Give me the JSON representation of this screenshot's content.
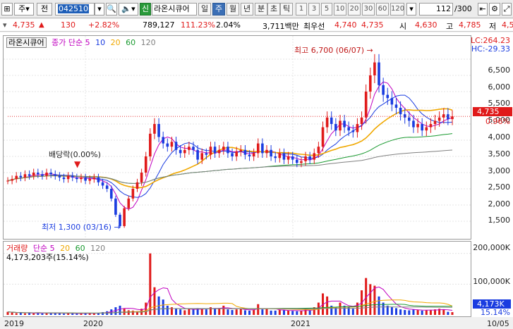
{
  "toolbar": {
    "market_label": "주",
    "jeon_label": "전",
    "code_value": "042510",
    "sin_label": "신",
    "stock_name": "라온시큐어",
    "period_day": "일",
    "period_week": "주",
    "period_month": "월",
    "period_year": "년",
    "period_min": "분",
    "period_sec": "초",
    "period_tick": "틱",
    "intervals": [
      "1",
      "3",
      "5",
      "10",
      "20",
      "30",
      "60",
      "120"
    ],
    "count_value": "112",
    "count_total": "/300"
  },
  "quote": {
    "price": "4,735",
    "change_arrow": "▲",
    "change": "130",
    "change_pct": "+2.82%",
    "volume": "789,127",
    "vol_ratio": "111.23%",
    "turnover": "2.04%",
    "amount": "3,711백만",
    "best_ask_label": "최우선",
    "best_ask": "4,740",
    "best_bid": "4,735",
    "open_label": "시",
    "open": "4,630",
    "high_label": "고",
    "high": "4,785",
    "low_label": "저",
    "low_partial": "4,5"
  },
  "legend": {
    "stock_name": "라온시큐어",
    "ma_label": "종가 단순",
    "ma_periods": [
      "5",
      "10",
      "20",
      "60",
      "120"
    ],
    "vol_label": "거래량",
    "vol_ma_label": "단순",
    "vol_ma_periods": [
      "5",
      "20",
      "60",
      "120"
    ],
    "vol_value": "4,173,203주(15.14%)"
  },
  "annotations": {
    "high": "최고 6,700 (06/07)",
    "low": "최저 1,300 (03/16)",
    "dividend": "배당락(0.00%)"
  },
  "price_axis": {
    "lc": "LC:264.23",
    "hc": "HC:-29.33",
    "current_price": "4,735",
    "current_pct": "0.96%",
    "ticks": [
      "6,500",
      "6,000",
      "5,500",
      "5,000",
      "4,500",
      "4,000",
      "3,500",
      "3,000",
      "2,500",
      "2,000",
      "1,500"
    ]
  },
  "volume_axis": {
    "ticks": [
      "200,000K",
      "100,000K"
    ],
    "current": "4,173K",
    "current_pct": "15.14%"
  },
  "dates": [
    "2019",
    "2020",
    "2021",
    "10/05"
  ],
  "colors": {
    "up": "#e01a1a",
    "down": "#1a3ce0",
    "ma5": "#c000c0",
    "ma10": "#1a3ce0",
    "ma20": "#f0a800",
    "ma60": "#1a9a30",
    "ma120": "#808080"
  },
  "chart_data": {
    "type": "candlestick",
    "title": "라온시큐어",
    "x": [
      "2019",
      "2020",
      "2021"
    ],
    "ylim": [
      1000,
      7000
    ],
    "high_point": {
      "value": 6700,
      "date": "06/07"
    },
    "low_point": {
      "value": 1300,
      "date": "03/16"
    },
    "close_series": [
      2750,
      2800,
      2900,
      2850,
      2950,
      2900,
      3000,
      2950,
      2900,
      3000,
      2950,
      2900,
      2850,
      2800,
      2900,
      2850,
      2800,
      2850,
      2750,
      2800,
      2850,
      2700,
      2600,
      2500,
      2200,
      1700,
      1350,
      1900,
      2200,
      2500,
      2700,
      3000,
      3500,
      4200,
      4500,
      4100,
      3900,
      3800,
      3950,
      3700,
      3600,
      3700,
      3800,
      3700,
      3400,
      3600,
      3550,
      3800,
      3600,
      3700,
      3800,
      3600,
      3500,
      3650,
      3700,
      3550,
      3500,
      3600,
      3900,
      3600,
      3700,
      3500,
      3450,
      3600,
      3400,
      3500,
      3400,
      3300,
      3350,
      3500,
      3400,
      3600,
      3800,
      4400,
      4700,
      4500,
      4300,
      4600,
      4400,
      4300,
      4250,
      4500,
      4700,
      5500,
      6000,
      6400,
      5700,
      5400,
      5300,
      5100,
      5000,
      4800,
      4700,
      4600,
      4400,
      4500,
      4300,
      4400,
      4500,
      4600,
      4700,
      4800,
      4650,
      4735
    ],
    "volume_series": [
      10,
      8,
      6,
      7,
      5,
      6,
      6,
      8,
      5,
      5,
      6,
      7,
      6,
      4,
      5,
      5,
      4,
      6,
      5,
      5,
      6,
      7,
      9,
      12,
      18,
      25,
      30,
      20,
      15,
      14,
      12,
      20,
      40,
      200,
      90,
      60,
      50,
      30,
      25,
      20,
      18,
      15,
      20,
      18,
      22,
      20,
      18,
      25,
      20,
      22,
      30,
      18,
      16,
      18,
      20,
      15,
      14,
      16,
      35,
      18,
      20,
      14,
      14,
      16,
      15,
      14,
      13,
      12,
      14,
      18,
      16,
      25,
      40,
      70,
      60,
      30,
      25,
      40,
      30,
      25,
      20,
      40,
      80,
      120,
      100,
      95,
      60,
      40,
      30,
      25,
      22,
      18,
      16,
      15,
      18,
      16,
      14,
      15,
      16,
      18,
      20,
      18,
      10,
      9
    ],
    "volume_unit": "K shares",
    "ma_periods": [
      5,
      10,
      20,
      60,
      120
    ]
  }
}
